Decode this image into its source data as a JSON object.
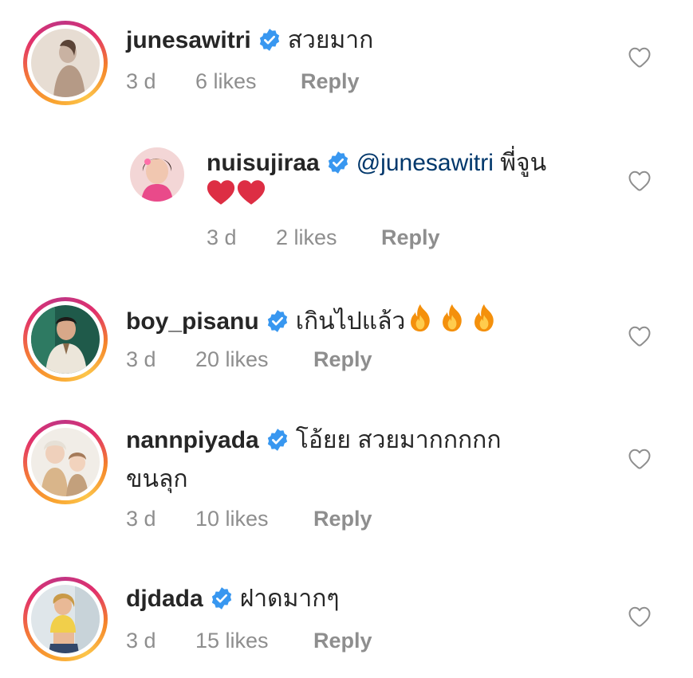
{
  "colors": {
    "username": "#262626",
    "meta": "#8e8e8e",
    "mention": "#00376b",
    "verified": "#3897f0"
  },
  "comments": [
    {
      "username": "junesawitri",
      "verified": true,
      "text": "สวยมาก",
      "time": "3 d",
      "likes": "6 likes",
      "reply_label": "Reply"
    },
    {
      "username": "nuisujiraa",
      "verified": true,
      "mention": "@junesawitri",
      "text": "พี่จูน",
      "emoji": [
        "red-heart",
        "red-heart"
      ],
      "time": "3 d",
      "likes": "2 likes",
      "reply_label": "Reply"
    },
    {
      "username": "boy_pisanu",
      "verified": true,
      "text": "เกินไปแล้ว",
      "emoji": [
        "fire",
        "fire",
        "fire"
      ],
      "time": "3 d",
      "likes": "20 likes",
      "reply_label": "Reply"
    },
    {
      "username": "nannpiyada",
      "verified": true,
      "text": "โอ้ยย สวยมากกกกก",
      "text_line2": "ขนลุก",
      "time": "3 d",
      "likes": "10 likes",
      "reply_label": "Reply"
    },
    {
      "username": "djdada",
      "verified": true,
      "text": "ฝาดมากๆ",
      "time": "3 d",
      "likes": "15 likes",
      "reply_label": "Reply"
    }
  ],
  "icons": {
    "like": "heart-outline-icon",
    "verified": "verified-badge-icon"
  }
}
